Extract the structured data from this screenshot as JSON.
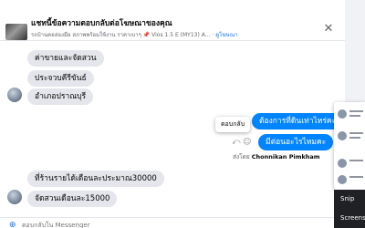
{
  "header": {
    "title": "แชทนี้ข้อความตอบกลับต่อโฆษณาของคุณ",
    "subtitle_text": "รถบ้านคอล่องมือ สภาพพร้อมใช้งาน ราคาเบาๆ",
    "subtitle_pin": "📌",
    "subtitle_car": "Vios 1.5 E (MY13) A...",
    "subtitle_link": "ดูโฆษณา"
  },
  "messages": [
    {
      "text": "ค่าขายและจัดสวน",
      "from": "them"
    },
    {
      "text": "ประจวบคีรีขันธ์",
      "from": "them"
    },
    {
      "text": "อำเภอปราณบุรี",
      "from": "them"
    },
    {
      "text": "ต้องการที่ดินเท่าไหร่คะ",
      "from": "me"
    },
    {
      "text": "มีต่อนอะไรไหมคะ",
      "from": "me"
    },
    {
      "text": "ที่ร้านรายได้เดือนละประมาณ30000",
      "from": "them"
    },
    {
      "text": "จัดสวนเดือนละ15000",
      "from": "them"
    }
  ],
  "tooltip": "ตอบกลับ",
  "sent_by": {
    "prefix": "ส่งโดย",
    "name": "Chonnikan Pimkham"
  },
  "composer": {
    "placeholder": "ตอบกลับใน Messenger"
  },
  "dark_panel": {
    "line1": "Snip",
    "line2": "Screens"
  },
  "icons": {
    "close": "close-icon",
    "reply": "reply-icon",
    "react": "smile-icon",
    "add": "plus-icon"
  },
  "colors": {
    "my_bubble": "#0084ff",
    "their_bubble": "#e4e6eb",
    "accent": "#1877f2"
  }
}
